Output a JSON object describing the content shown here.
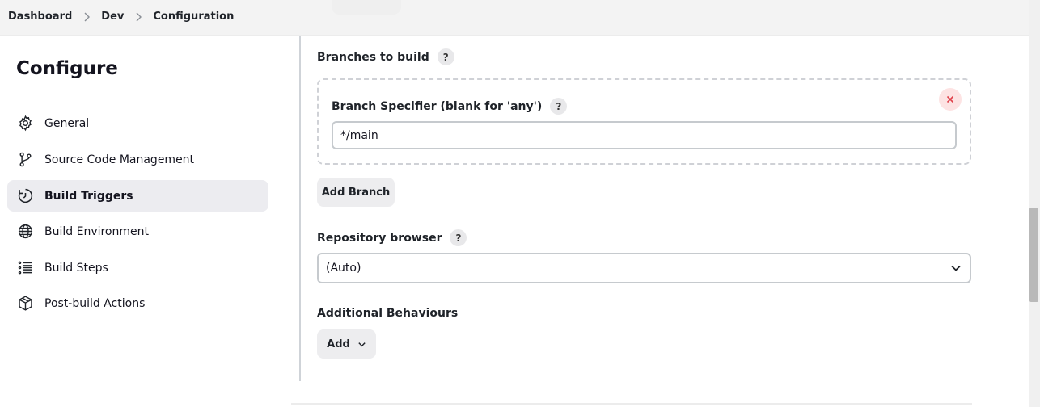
{
  "breadcrumb": {
    "items": [
      "Dashboard",
      "Dev",
      "Configuration"
    ]
  },
  "sidebar": {
    "title": "Configure",
    "items": [
      {
        "label": "General",
        "icon": "gear-icon",
        "active": false
      },
      {
        "label": "Source Code Management",
        "icon": "branch-icon",
        "active": false
      },
      {
        "label": "Build Triggers",
        "icon": "clock-icon",
        "active": true
      },
      {
        "label": "Build Environment",
        "icon": "globe-icon",
        "active": false
      },
      {
        "label": "Build Steps",
        "icon": "list-icon",
        "active": false
      },
      {
        "label": "Post-build Actions",
        "icon": "package-icon",
        "active": false
      }
    ]
  },
  "main": {
    "branches_label": "Branches to build",
    "branch_specifier_label": "Branch Specifier (blank for 'any')",
    "branch_specifier_value": "*/main",
    "add_branch_label": "Add Branch",
    "repo_browser_label": "Repository browser",
    "repo_browser_value": "(Auto)",
    "additional_behaviours_label": "Additional Behaviours",
    "add_label": "Add",
    "help_glyph": "?"
  },
  "colors": {
    "active_bg": "#ececf0",
    "close_bg": "#fde3e3",
    "close_x": "#e0414b"
  }
}
